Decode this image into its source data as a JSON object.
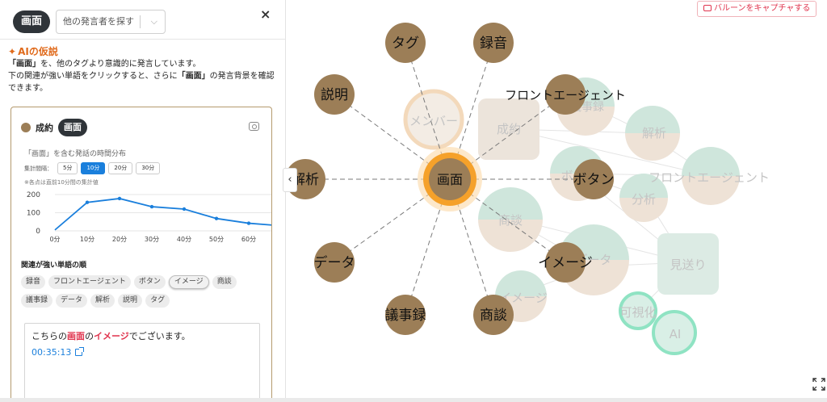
{
  "header": {
    "speaker_chip": "画面",
    "search_placeholder": "他の発言者を探す",
    "close": "×"
  },
  "ai": {
    "title": "AIの仮説",
    "line1_bold": "「画面」",
    "line1_rest": "を、他のタグより意識的に発言しています。",
    "line2_pre": "下の関連が強い単語をクリックすると、さらに",
    "line2_bold": "「画面」",
    "line2_post": "の発言背景を確認できます。"
  },
  "card": {
    "label": "成約",
    "chip": "画面",
    "chart_title": "「画面」を含む発話の時間分布",
    "interval_label": "集計間隔：",
    "intervals": [
      "5分",
      "10分",
      "20分",
      "30分"
    ],
    "active_interval": "10分",
    "note": "※各点は直前10分間の集計値",
    "related_title": "関連が強い単語の順",
    "tags": [
      "録音",
      "フロントエージェント",
      "ボタン",
      "イメージ",
      "商談",
      "議事録",
      "データ",
      "解析",
      "説明",
      "タグ"
    ],
    "selected_tag": "イメージ",
    "quote": {
      "pre": "こちらの",
      "hl1": "画面",
      "mid": "の",
      "hl2": "イメージ",
      "post": "でございます。",
      "time": "00:35:13"
    }
  },
  "chart_data": {
    "type": "line",
    "x": [
      "0分",
      "10分",
      "20分",
      "30分",
      "40分",
      "50分",
      "60分"
    ],
    "values": [
      5,
      157,
      178,
      133,
      120,
      68,
      42,
      28
    ],
    "yticks": [
      "0",
      "100",
      "200"
    ],
    "ylim": [
      0,
      200
    ],
    "color": "#1a7fdc"
  },
  "graph": {
    "capture_label": "バルーンをキャプチャする",
    "center": "画面",
    "spokes": [
      "タグ",
      "録音",
      "説明",
      "フロントエージェント",
      "解析",
      "ボタン",
      "データ",
      "イメージ",
      "議事録",
      "商談"
    ],
    "background_words": [
      "メンバー",
      "成約",
      "議事録",
      "解析",
      "フロントエージェント",
      "分析",
      "ボタン",
      "商談",
      "データ",
      "見送り",
      "イメージ",
      "可視化",
      "AI"
    ],
    "colors": {
      "spoke": "#9c7e57",
      "center_ring": "#f5a12a",
      "bubble_teal": "#cfe6dc",
      "bubble_beige": "#eee2d6",
      "ring_teal": "#8fe3c3"
    }
  }
}
